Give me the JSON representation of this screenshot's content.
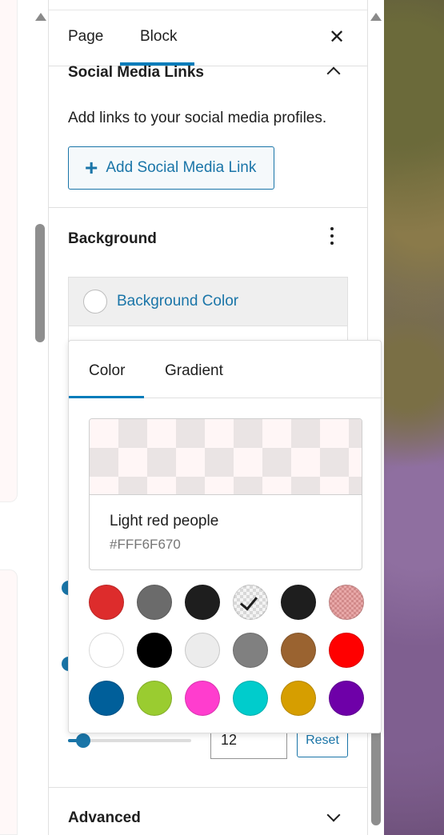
{
  "sidebar": {
    "tabs": {
      "page": "Page",
      "block": "Block",
      "active": "Block"
    },
    "close_symbol": "✕",
    "social_section": {
      "title": "Social Media Links",
      "help_text": "Add links to your social media profiles.",
      "add_button_label": "Add Social Media Link"
    },
    "background_section": {
      "title": "Background",
      "item_label": "Background Color"
    },
    "size_control": {
      "value": "12",
      "reset_label": "Reset"
    },
    "advanced_section": {
      "title": "Advanced"
    }
  },
  "color_popover": {
    "tabs": {
      "color": "Color",
      "gradient": "Gradient",
      "active": "Color"
    },
    "selected_color": {
      "name": "Light red people",
      "hex": "#FFF6F670"
    },
    "swatches": [
      {
        "name": "red",
        "hex": "#dd2c2c",
        "type": "solid"
      },
      {
        "name": "dark-gray",
        "hex": "#6b6b6b",
        "type": "solid"
      },
      {
        "name": "near-black",
        "hex": "#1e1e1e",
        "type": "solid"
      },
      {
        "name": "transparent-selected",
        "hex": "#f4f4f4",
        "type": "checkered-selected"
      },
      {
        "name": "near-black-2",
        "hex": "#1e1e1e",
        "type": "solid"
      },
      {
        "name": "pink-transparent",
        "hex": "#e8a8a8",
        "type": "pink-checkered"
      },
      {
        "name": "white",
        "hex": "#ffffff",
        "type": "solid"
      },
      {
        "name": "black",
        "hex": "#000000",
        "type": "solid"
      },
      {
        "name": "light-gray",
        "hex": "#ececec",
        "type": "solid"
      },
      {
        "name": "gray",
        "hex": "#808080",
        "type": "solid"
      },
      {
        "name": "brown",
        "hex": "#9a6330",
        "type": "solid"
      },
      {
        "name": "bright-red",
        "hex": "#ff0000",
        "type": "solid"
      },
      {
        "name": "blue",
        "hex": "#005f9a",
        "type": "solid"
      },
      {
        "name": "lime-green",
        "hex": "#9acc30",
        "type": "solid"
      },
      {
        "name": "magenta",
        "hex": "#ff3dce",
        "type": "solid"
      },
      {
        "name": "cyan",
        "hex": "#00cccc",
        "type": "solid"
      },
      {
        "name": "gold",
        "hex": "#d69e00",
        "type": "solid"
      },
      {
        "name": "purple",
        "hex": "#6e00a8",
        "type": "solid"
      }
    ]
  },
  "accent_color": "#1a75a8"
}
